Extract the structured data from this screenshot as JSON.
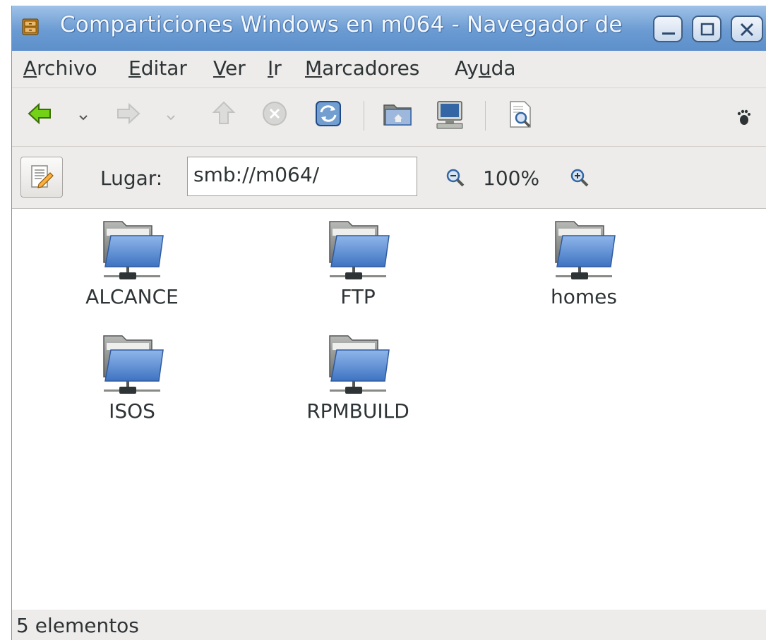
{
  "window": {
    "title": "Comparticiones Windows en m064 - Navegador de"
  },
  "menu": [
    {
      "label_pre": "",
      "label_ul": "A",
      "label_post": "rchivo"
    },
    {
      "label_pre": "",
      "label_ul": "E",
      "label_post": "ditar"
    },
    {
      "label_pre": "",
      "label_ul": "V",
      "label_post": "er"
    },
    {
      "label_pre": "",
      "label_ul": "I",
      "label_post": "r"
    },
    {
      "label_pre": "",
      "label_ul": "M",
      "label_post": "arcadores"
    },
    {
      "label_pre": "Ay",
      "label_ul": "u",
      "label_post": "da"
    }
  ],
  "location": {
    "label": "Lugar:",
    "value": "smb://m064/"
  },
  "zoom": {
    "level": "100%"
  },
  "items": [
    {
      "label": "ALCANCE"
    },
    {
      "label": "FTP"
    },
    {
      "label": "homes"
    },
    {
      "label": "ISOS"
    },
    {
      "label": "RPMBUILD"
    }
  ],
  "status": {
    "text": "5 elementos"
  },
  "icons": [
    "file-cabinet-icon",
    "back-arrow-icon",
    "forward-arrow-icon",
    "up-arrow-icon",
    "stop-icon",
    "reload-icon",
    "home-folder-icon",
    "computer-icon",
    "search-icon",
    "gnome-foot-icon",
    "edit-location-icon",
    "zoom-out-icon",
    "zoom-in-icon",
    "network-folder-icon"
  ],
  "colors": {
    "titlebar": "#6b9bd2",
    "folder_blue": "#5a8ed8",
    "back_arrow": "#4e9a06"
  }
}
